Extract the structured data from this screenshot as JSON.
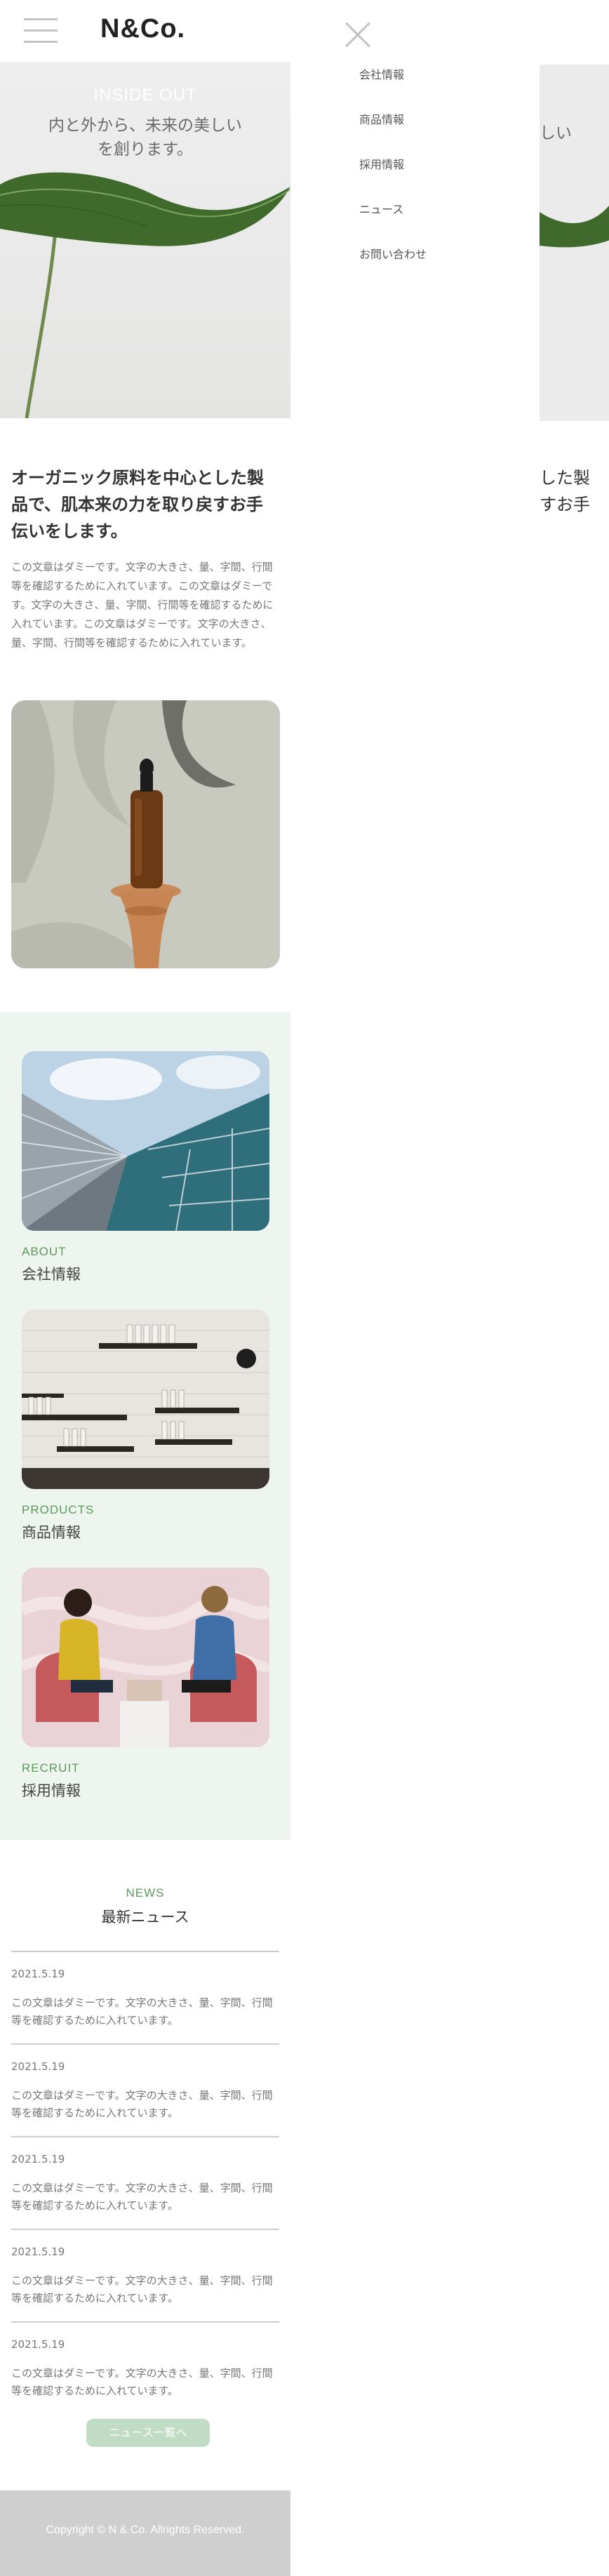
{
  "header": {
    "logo": "N&Co."
  },
  "hero": {
    "tagline_en": "INSIDE OUT",
    "tagline_jp_line1": "内と外から、未来の美しい",
    "tagline_jp_line2": "を創ります。"
  },
  "intro": {
    "title": "オーガニック原料を中心とした製品で、肌本来の力を取り戻すお手伝いをします。",
    "body": "この文章はダミーです。文字の大きさ、量、字間、行間等を確認するために入れています。この文章はダミーです。文字の大きさ、量、字間、行間等を確認するために入れています。この文章はダミーです。文字の大きさ、量、字間、行間等を確認するために入れています。"
  },
  "links": [
    {
      "en": "ABOUT",
      "jp": "会社情報"
    },
    {
      "en": "PRODUCTS",
      "jp": "商品情報"
    },
    {
      "en": "RECRUIT",
      "jp": "採用情報"
    }
  ],
  "news": {
    "heading_en": "NEWS",
    "heading_jp": "最新ニュース",
    "items": [
      {
        "date": "2021.5.19",
        "text": "この文章はダミーです。文字の大きさ、量、字間、行間等を確認するために入れています。"
      },
      {
        "date": "2021.5.19",
        "text": "この文章はダミーです。文字の大きさ、量、字間、行間等を確認するために入れています。"
      },
      {
        "date": "2021.5.19",
        "text": "この文章はダミーです。文字の大きさ、量、字間、行間等を確認するために入れています。"
      },
      {
        "date": "2021.5.19",
        "text": "この文章はダミーです。文字の大きさ、量、字間、行間等を確認するために入れています。"
      },
      {
        "date": "2021.5.19",
        "text": "この文章はダミーです。文字の大きさ、量、字間、行間等を確認するために入れています。"
      }
    ],
    "button_label": "ニュース一覧へ"
  },
  "footer": {
    "copyright": "Copyright © N & Co. Allrights Reserved."
  },
  "menu": {
    "items": [
      "会社情報",
      "商品情報",
      "採用情報",
      "ニュース",
      "お問い合わせ"
    ],
    "behind_hero_fragment": "しい",
    "behind_title_line1": "した製",
    "behind_title_line2": "すお手"
  },
  "icons": {
    "menu": "hamburger-icon",
    "close": "close-icon"
  },
  "colors": {
    "accent_green": "#5c9a5c",
    "section_bg": "#eef5ee",
    "button_bg": "#c1dcc4",
    "footer_bg": "#cfcfcf"
  }
}
